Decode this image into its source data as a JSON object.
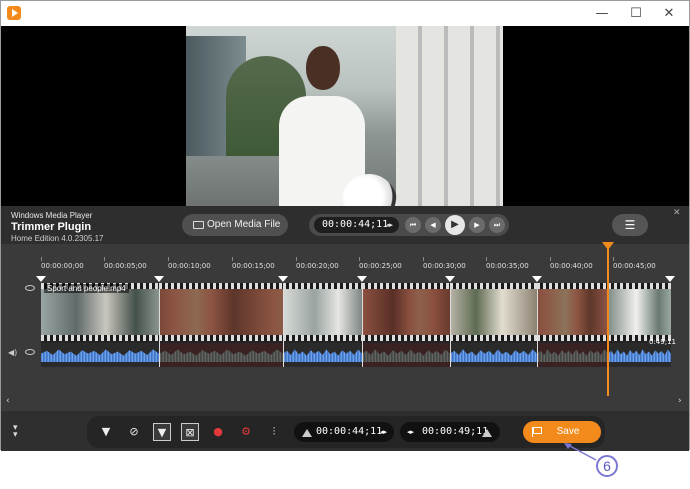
{
  "window": {
    "minimize": "—",
    "maximize": "☐",
    "close": "✕"
  },
  "header": {
    "app_name": "Windows Media Player",
    "plugin_name": "Trimmer Plugin",
    "edition": "Home Edition 4.0.2305.17"
  },
  "toolbar_top": {
    "open_label": "Open Media File",
    "current_time": "00:00:44;11",
    "menu_icon": "☰"
  },
  "ruler": {
    "ticks": [
      "00:00:00;00",
      "00:00:05;00",
      "00:00:10;00",
      "00:00:15;00",
      "00:00:20;00",
      "00:00:25;00",
      "00:00:30;00",
      "00:00:35;00",
      "00:00:40;00",
      "00:00:45;00"
    ]
  },
  "track": {
    "file_name": "Sport and people.mp4",
    "end_time": "0:49;11"
  },
  "bottom": {
    "start_time": "00:00:44;11",
    "end_time": "00:00:49;11",
    "save_label": "Save"
  },
  "annotation": {
    "step": "6"
  },
  "colors": {
    "accent": "#f28a1c",
    "panel": "#3a3a3a",
    "waveform": "#4f86d6",
    "annotation": "#7b78d4"
  }
}
